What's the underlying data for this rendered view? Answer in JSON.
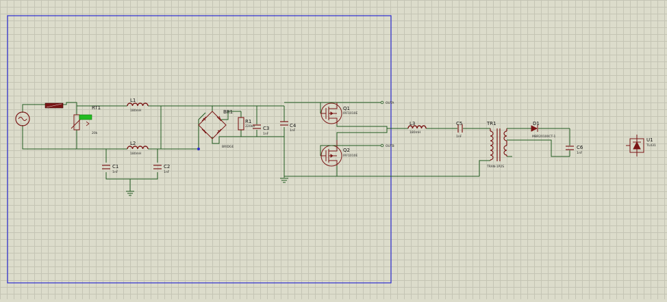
{
  "schematic": {
    "components": {
      "rt1": {
        "ref": "RT1",
        "value": "20k"
      },
      "l1": {
        "ref": "L1",
        "value": "180mH"
      },
      "l2": {
        "ref": "L2",
        "value": "180mH"
      },
      "c1": {
        "ref": "C1",
        "value": "1nF"
      },
      "c2": {
        "ref": "C2",
        "value": "1nF"
      },
      "br1": {
        "ref": "BR1",
        "value": "BRIDGE"
      },
      "r1": {
        "ref": "R1",
        "value": "220kR"
      },
      "c3": {
        "ref": "C3",
        "value": "1nF"
      },
      "c4": {
        "ref": "C4",
        "value": "1nF"
      },
      "q1": {
        "ref": "Q1",
        "value": "IRF1010E"
      },
      "q2": {
        "ref": "Q2",
        "value": "IRF1010E"
      },
      "l3": {
        "ref": "L3",
        "value": "180mH"
      },
      "c5": {
        "ref": "C5",
        "value": "1nF"
      },
      "tr1": {
        "ref": "TR1",
        "value": "TRAN-1P2S"
      },
      "d1": {
        "ref": "D1",
        "value": "MBR20100CT-1"
      },
      "c6": {
        "ref": "C6",
        "value": "1nF"
      },
      "u1": {
        "ref": "U1",
        "value": "TL431"
      }
    },
    "terminals": {
      "outa": "OUTA",
      "outb": "OUTB"
    },
    "colors": {
      "wire": "#1f5a1f",
      "part": "#7a1515",
      "selection": "#2a2ad0",
      "grid": "#c4c4b4",
      "background": "#dcdccb"
    }
  }
}
